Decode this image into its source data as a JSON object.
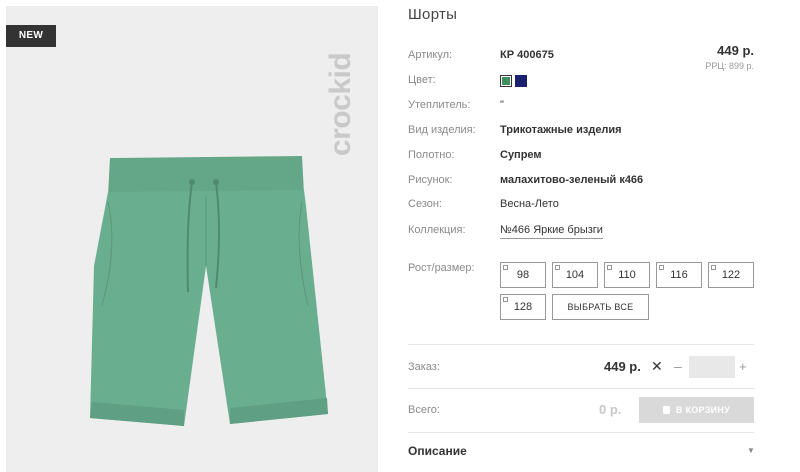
{
  "badge": "NEW",
  "brand_text": "crockid",
  "product": {
    "title": "Шорты",
    "price": "449 р.",
    "rrp": "РРЦ: 899 р."
  },
  "attributes": {
    "article": {
      "label": "Артикул:",
      "value": "КР 400675"
    },
    "color": {
      "label": "Цвет:"
    },
    "insulation": {
      "label": "Утеплитель:",
      "value": "\""
    },
    "kind": {
      "label": "Вид изделия:",
      "value": "Трикотажные изделия"
    },
    "fabric": {
      "label": "Полотно:",
      "value": "Супрем"
    },
    "pattern": {
      "label": "Рисунок:",
      "value": "малахитово-зеленый к466"
    },
    "season": {
      "label": "Сезон:",
      "value": "Весна-Лето"
    },
    "collection": {
      "label": "Коллекция:",
      "value": "№466 Яркие брызги"
    }
  },
  "colors": [
    {
      "name": "green",
      "hex": "#3f8f5e",
      "selected": true
    },
    {
      "name": "navy",
      "hex": "#1a1f6e",
      "selected": false
    }
  ],
  "sizes": {
    "label": "Рост/размер:",
    "options": [
      "98",
      "104",
      "110",
      "116",
      "122",
      "128"
    ],
    "select_all": "ВЫБРАТЬ ВСЕ"
  },
  "order": {
    "label": "Заказ:",
    "price": "449 р.",
    "times": "✕",
    "minus": "–",
    "plus": "+"
  },
  "total": {
    "label": "Всего:",
    "value": "0 р.",
    "cart_button": "В КОРЗИНУ"
  },
  "description": {
    "label": "Описание",
    "arrow": "▼"
  },
  "theme": {
    "shorts_color": "#6aae90",
    "badge_bg": "#333333"
  }
}
